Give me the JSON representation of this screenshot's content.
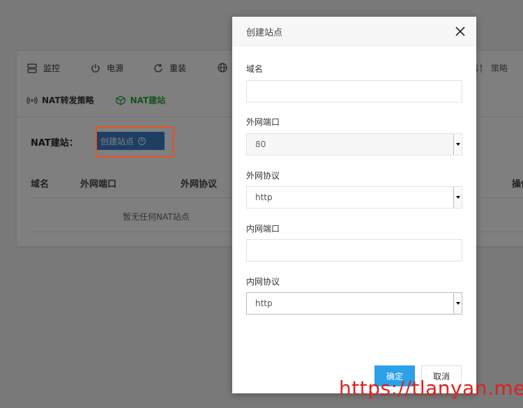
{
  "toolbar": {
    "monitor_label": "监控",
    "power_label": "电源",
    "reinstall_label": "重装",
    "policy_label": "策略"
  },
  "tabs": {
    "nat_forward": "NAT转发策略",
    "nat_site": "NAT建站"
  },
  "section": {
    "nat_label": "NAT建站：",
    "create_button": "创建站点"
  },
  "table": {
    "headers": [
      "域名",
      "外网端口",
      "外网协议",
      "操作"
    ],
    "empty_text": "暂无任何NAT站点"
  },
  "modal": {
    "title": "创建站点",
    "fields": {
      "domain_label": "域名",
      "domain_value": "",
      "ext_port_label": "外网端口",
      "ext_port_value": "80",
      "ext_proto_label": "外网协议",
      "ext_proto_value": "http",
      "int_port_label": "内网端口",
      "int_port_value": "",
      "int_proto_label": "内网协议",
      "int_proto_value": "http"
    },
    "confirm_label": "确定",
    "cancel_label": "取消"
  },
  "watermark": "https://tlanyan.me",
  "colors": {
    "accent_green": "#2aa43e",
    "button_blue": "#3d7ec9",
    "confirm_blue": "#2aa1e8",
    "highlight_orange": "#e8531f",
    "watermark_red": "#e0211f"
  }
}
